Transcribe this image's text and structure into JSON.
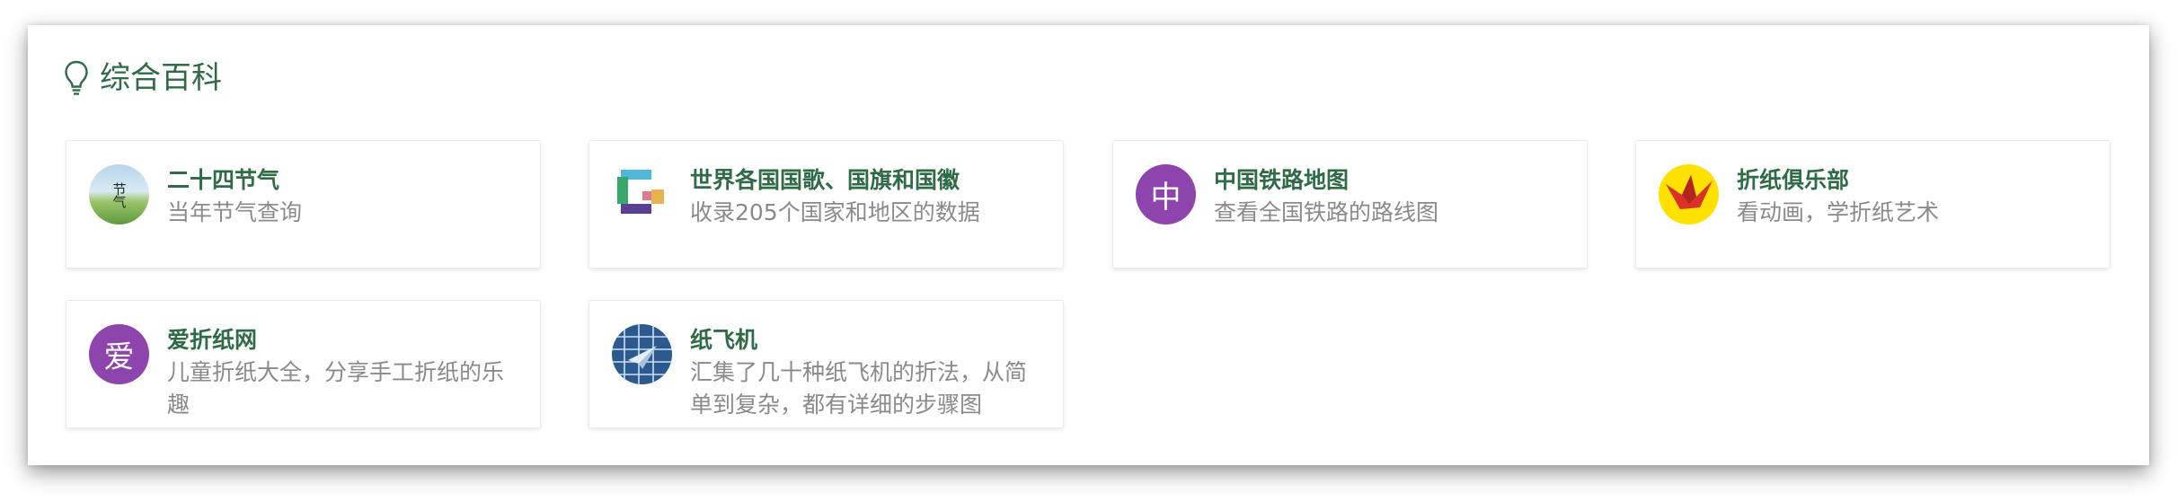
{
  "section": {
    "title": "综合百科",
    "icon": "lightbulb-icon",
    "accent_color": "#2e6b46"
  },
  "cards": [
    {
      "name": "二十四节气",
      "desc": "当年节气查询",
      "icon": "solar-terms-icon",
      "icon_text": "节气"
    },
    {
      "name": "世界各国国歌、国旗和国徽",
      "desc": "收录205个国家和地区的数据",
      "icon": "flags-anthems-icon"
    },
    {
      "name": "中国铁路地图",
      "desc": "查看全国铁路的路线图",
      "icon": "letter-avatar-icon",
      "icon_text": "中",
      "icon_color": "#8e44ad"
    },
    {
      "name": "折纸俱乐部",
      "desc": "看动画，学折纸艺术",
      "icon": "paper-crane-icon"
    },
    {
      "name": "爱折纸网",
      "desc": "儿童折纸大全，分享手工折纸的乐趣",
      "icon": "letter-avatar-icon",
      "icon_text": "爱",
      "icon_color": "#8e44ad"
    },
    {
      "name": "纸飞机",
      "desc": "汇集了几十种纸飞机的折法，从简单到复杂，都有详细的步骤图",
      "icon": "paper-plane-icon"
    }
  ]
}
